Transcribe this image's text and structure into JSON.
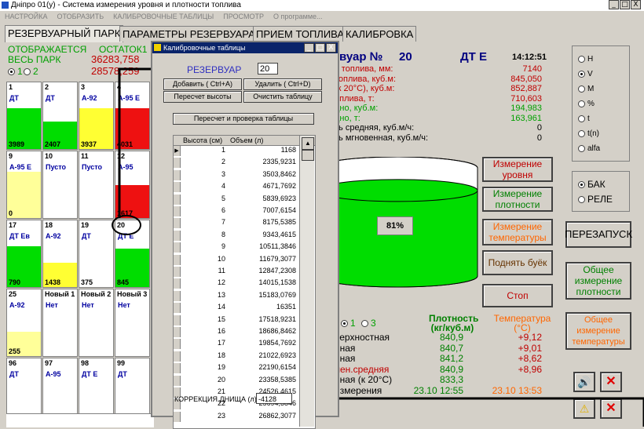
{
  "window": {
    "title": "Днiпро 01(у) - Система измерения уровня и плотности топлива",
    "controls": [
      "_",
      "□",
      "X"
    ]
  },
  "menu": [
    "НАСТРОЙКА",
    "ОТОБРАЗИТЬ",
    "КАЛИБРОВОЧНЫЕ ТАБЛИЦЫ",
    "ПРОСМОТР",
    "О программе..."
  ],
  "tabs": [
    "РЕЗЕРВУАРНЫЙ ПАРК",
    "ПАРАМЕТРЫ РЕЗЕРВУАРА",
    "ПРИЕМ ТОПЛИВА",
    "КАЛИБРОВКА"
  ],
  "park": {
    "header_left": "ОТОБРАЖАЕТСЯ",
    "header_right": "ОСТАТОК1",
    "all": "ВЕСЬ ПАРК",
    "val1": "36283,758",
    "radio1": "1",
    "radio2": "2",
    "val2": "28578,259"
  },
  "tiles": [
    {
      "num": "1",
      "fuel": "ДТ",
      "val": "3989",
      "color": "#00dd00",
      "level": 0.75
    },
    {
      "num": "2",
      "fuel": "ДТ",
      "val": "2407",
      "color": "#00dd00",
      "level": 0.5
    },
    {
      "num": "3",
      "fuel": "А-92",
      "val": "3937",
      "color": "#ffff33",
      "level": 0.75
    },
    {
      "num": "4",
      "fuel": "А-95 Е",
      "val": "4031",
      "color": "#ee1111",
      "level": 0.75
    },
    {
      "num": "9",
      "fuel": "А-95 Е",
      "val": "0",
      "color": "#ffff99",
      "level": 0.85
    },
    {
      "num": "10",
      "fuel": "Пусто",
      "val": "",
      "color": "#ffffff",
      "level": 0
    },
    {
      "num": "11",
      "fuel": "Пусто",
      "val": "",
      "color": "#ffffff",
      "level": 0
    },
    {
      "num": "12",
      "fuel": "А-95",
      "val": "1617",
      "color": "#ee1111",
      "level": 0.6
    },
    {
      "num": "17",
      "fuel": "ДТ Ев",
      "val": "790",
      "color": "#00dd00",
      "level": 0.75
    },
    {
      "num": "18",
      "fuel": "А-92",
      "val": "1438",
      "color": "#ffff33",
      "level": 0.45
    },
    {
      "num": "19",
      "fuel": "ДТ",
      "val": "375",
      "color": "#ffffff",
      "level": 0
    },
    {
      "num": "20",
      "fuel": "ДТ Е",
      "val": "845",
      "color": "#00dd00",
      "level": 0.7
    },
    {
      "num": "25",
      "fuel": "А-92",
      "val": "255",
      "color": "#ffff99",
      "level": 0.45
    },
    {
      "num": "Новый 1",
      "fuel": "Нет",
      "val": "",
      "color": "#ffffff",
      "level": 0
    },
    {
      "num": "Новый 2",
      "fuel": "Нет",
      "val": "",
      "color": "#ffffff",
      "level": 0
    },
    {
      "num": "Новый 3",
      "fuel": "Нет",
      "val": "",
      "color": "#ffffff",
      "level": 0
    },
    {
      "num": "96",
      "fuel": "ДТ",
      "val": "",
      "color": "#ffffff",
      "level": 0
    },
    {
      "num": "97",
      "fuel": "А-95",
      "val": "",
      "color": "#ffffff",
      "level": 0
    },
    {
      "num": "98",
      "fuel": "ДТ Е",
      "val": "",
      "color": "#ffffff",
      "level": 0
    },
    {
      "num": "99",
      "fuel": "ДТ",
      "val": "",
      "color": "#ffffff",
      "level": 0
    }
  ],
  "dialog": {
    "title": "Калибровочные таблицы",
    "reservoir_label": "РЕЗЕРВУАР",
    "reservoir_value": "20",
    "btn_add": "Добавить ( Ctrl+A)",
    "btn_delete": "Удалить  ( Ctrl+D)",
    "btn_recalc_heights": "Пересчет высоты",
    "btn_clear": "Очистить таблицу",
    "btn_recheck": "Пересчет и проверка таблицы",
    "col_height": "Высота (см)",
    "col_volume": "Объем (л)",
    "rows": [
      [
        "1",
        "1168"
      ],
      [
        "2",
        "2335,9231"
      ],
      [
        "3",
        "3503,8462"
      ],
      [
        "4",
        "4671,7692"
      ],
      [
        "5",
        "5839,6923"
      ],
      [
        "6",
        "7007,6154"
      ],
      [
        "7",
        "8175,5385"
      ],
      [
        "8",
        "9343,4615"
      ],
      [
        "9",
        "10511,3846"
      ],
      [
        "10",
        "11679,3077"
      ],
      [
        "11",
        "12847,2308"
      ],
      [
        "12",
        "14015,1538"
      ],
      [
        "13",
        "15183,0769"
      ],
      [
        "14",
        "16351"
      ],
      [
        "15",
        "17518,9231"
      ],
      [
        "16",
        "18686,8462"
      ],
      [
        "17",
        "19854,7692"
      ],
      [
        "18",
        "21022,6923"
      ],
      [
        "19",
        "22190,6154"
      ],
      [
        "20",
        "23358,5385"
      ],
      [
        "21",
        "24526,4615"
      ],
      [
        "22",
        "25694,3846"
      ],
      [
        "23",
        "26862,3077"
      ]
    ],
    "bottom_label": "КОРРЕКЦИЯ ДНИЩА (л)",
    "bottom_value": "-4128"
  },
  "params": {
    "tank_label": "вуар №",
    "tank_num": "20",
    "fuel": "ДТ Е",
    "time": "14:12:51",
    "lines": [
      {
        "label": "ь топлива, мм:",
        "value": "7140",
        "color": "#c00000"
      },
      {
        "label": "топлива, куб.м:",
        "value": "845,050",
        "color": "#c00000"
      },
      {
        "label": "(к 20°С), куб.м:",
        "value": "852,887",
        "color": "#c00000"
      },
      {
        "label": "оплива, т:",
        "value": "710,603",
        "color": "#c00000"
      },
      {
        "label": "дно, куб.м:",
        "value": "194,983",
        "color": "#00a000"
      },
      {
        "label": "дно, т:",
        "value": "163,961",
        "color": "#00a000"
      },
      {
        "label": "ть средняя, куб.м/ч:",
        "value": "0",
        "color": "#000000"
      },
      {
        "label": "ть мгновенная, куб.м/ч:",
        "value": "0",
        "color": "#000000"
      }
    ],
    "fill_pct": "81%",
    "fill_level": 0.81
  },
  "actions": [
    "Измерение уровня",
    "Измерение плотности",
    "Измерение температуры",
    "Поднять буёк",
    "Стоп"
  ],
  "units": [
    "Н",
    "V",
    "M",
    "%",
    "t",
    "t(n)",
    "alfa"
  ],
  "unit_selected": 1,
  "mode": [
    "БАК",
    "РЕЛЕ"
  ],
  "restart": "ПЕРЕЗАПУСК",
  "general_density": "Общее измерение плотности",
  "general_temp": "Общее измерение температуры",
  "measure": {
    "radio1": "1",
    "radio3": "3",
    "density_hdr": "Плотность (кг/куб.м)",
    "temp_hdr": "Температура (°С)",
    "rows": [
      {
        "label": "верхностная",
        "density": "840,9",
        "temp": "+9,12",
        "color": "#000000"
      },
      {
        "label": "нная",
        "density": "840,7",
        "temp": "+9,01",
        "color": "#000000"
      },
      {
        "label": "нная",
        "density": "841,2",
        "temp": "+8,62",
        "color": "#000000"
      },
      {
        "label": "лен.средняя",
        "density": "840,9",
        "temp": "+8,96",
        "color": "#c00000"
      },
      {
        "label": "нная (к 20°С)",
        "density": "833,3",
        "temp": "",
        "color": "#000000"
      },
      {
        "label": "измерения",
        "density": "23.10 12:55",
        "temp": "23.10 13:53",
        "color": "#000000"
      }
    ]
  }
}
